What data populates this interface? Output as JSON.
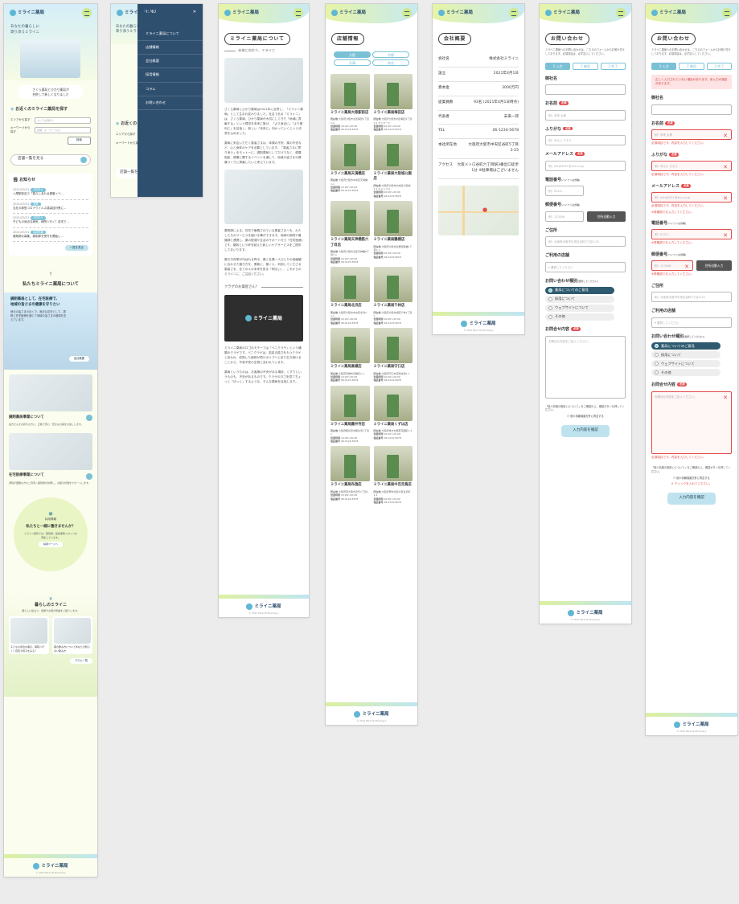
{
  "brand": {
    "name": "ミライニ薬局",
    "footer_copy": "© 2021 Mirai Ni Pharmacy"
  },
  "home": {
    "hero_text": [
      "あなたの暮らしに",
      "寄り添うミライニ"
    ],
    "hero_sub": [
      "さくら薬局とひかり薬局が",
      "合併して新しくなりました"
    ],
    "search_title": "お近くのミライニ薬局を探す",
    "area_label": "エリアから探す",
    "area_select": "エリアを選択",
    "keyword_label": "キーワードから探す",
    "keyword_placeholder": "店舗、キーワードなど",
    "search_button": "検索",
    "shop_list_button": "店舗一覧を見る",
    "news_title": "お知らせ",
    "news": [
      {
        "date": "2021/03/31",
        "tag": "お知らせ",
        "text": "八尾駅前店で「暮らしあれる健康イベ…"
      },
      {
        "date": "2021/03/31",
        "tag": "営業",
        "text": "当社の新型コロナウイルス感染症対策に…"
      },
      {
        "date": "2021/03/31",
        "tag": "お知らせ",
        "text": "子どもの身近な病気、病院へ行く？自宅で…"
      },
      {
        "date": "2021/03/31",
        "tag": "採用情報",
        "text": "薬剤師大募集。薬剤師を受付を開始し…"
      }
    ],
    "news_more": "一覧を見る",
    "about_title": "私たちミライニ薬局について",
    "about_box_title": [
      "調剤薬局として、在宅医療で、",
      "地域の皆さまの健康を守りたい"
    ],
    "about_box_text": "地元の皆さまの近くで、身近な存在として、調剤と在宅医療を通じて地域の皆さまの健康を支えています。",
    "about_more": "会社概要",
    "svc1_title": "調剤薬局事業について",
    "svc1_text": "処方せんをお持ちの方に、正確で安心・安全なお薬をお渡しします。",
    "svc2_title": "在宅医療事業について",
    "svc2_text": "通院が困難な方のご自宅へ薬剤師が訪問し、お薬の管理をサポートします。",
    "recruit_small": "採用情報",
    "recruit_title": "私たちと一緒に働きませんか？",
    "recruit_text": "ミライニ薬局では、薬剤師・医療事務スタッフを募集しています。",
    "recruit_btn": "採用ページへ",
    "column_title": "暮らしのミライニ",
    "column_sub": "暮らしに役立つ、健康やお薬の知識をご紹介します。",
    "column_items": [
      "子どもの身近な病気、病院へ行く？自宅で様子をみる？",
      "薬の飲み方についてあなたの知らない飲み方"
    ],
    "column_more": "コラム一覧"
  },
  "menu": {
    "title": "MENU",
    "items": [
      "ミライニ薬局について",
      "店舗情報",
      "会社概要",
      "採用情報",
      "コラム",
      "お問い合わせ"
    ],
    "peek_hero": [
      "あなたの暮らしに",
      "寄り添うミライニ"
    ],
    "peek_search": "お近くのミライニ薬局を探す",
    "peek_area": "エリアから探す",
    "peek_keyword": "キーワードから探す",
    "peek_shoplist": "店舗一覧を見る"
  },
  "about": {
    "title": "ミライニ薬局について",
    "subtitle": "未来に向かう、ミライニ",
    "p1": "さくら薬局とひかり薬局は2021年に合併し、「ミライニ薬局」として生まれ変わりました。社名である「ミライニ」は、さくら薬局、ひかり薬局が大切にしてきた「地域に貢献する」という理念を未来に繋げ、「より身近に」「より便利に」を目指し、新しい「未来に」向かっていくという決意を込めました。",
    "p2": "薬局に来店いただく患者さまは、体調の不安、薬の不安など、心と身体のケアを必要としています。「患者さまに寄り添う」をモットーに、調剤薬局としてだけでなく、健康相談、健康に関するイベントを通して、地域の皆さまの健康づくりに貢献したいと考えています。",
    "p3": "薬剤師による、在宅で療養されている患者さまへも、わたしたちのサービスを届ける事ができます。地域の病院や看護師と連携し、薬の配達や生活のサポート行う「在宅医療」です。薬剤という杯を越えた新しいケアサービスをご提供してまいります。",
    "p4": "働き方改革が叫ばれる昨今、働く社員一人ひとりの価値観に合わせた働き方を、柔軟に、働く人、利用してくださる患者さま、全ての人の未来を見る「明るい」、これからのミライニに、ご注目ください。",
    "sec2_title": "クラゲのお薬屋さん？",
    "p5": "ミライニ薬局のロゴのモチーフは「ベニクラゲ」という種類のクラゲです。ベニクラゲは、若返る能力をもつクラゲと言われ、成熟した個体が再びポリプへと戻り生き続けることから、不老不死の生物と言われています。",
    "p6": "薬局というものは、お客様の不安がある場所、くすりというものも、不安があるものです。クラゲのロゴを見てちょっと「ほっと」するような、そんな薬局を目指します。"
  },
  "shops": {
    "title": "店舗情報",
    "tabs": [
      "大阪",
      "京都",
      "兵庫",
      "奈良"
    ],
    "addr_label": "所在地",
    "hours_label": "営業時間",
    "tel_label": "電話番号",
    "hours": "10:00〜20:00",
    "tel": "06-0123-5678",
    "items": [
      {
        "name": "ミライニ薬局大阪駅前店",
        "addr": "大阪府大阪市北区梅田1丁目1-1"
      },
      {
        "name": "ミライニ薬局梅田店",
        "addr": "大阪府大阪市北区梅田1丁目1-1 サンワード"
      },
      {
        "name": "ミライニ薬局天満橋店",
        "addr": "大阪府大阪市中央区天満橋1-1"
      },
      {
        "name": "ミライニ薬局大阪城公園店",
        "addr": "大阪府大阪市中央区大阪城1-1 キャッスル"
      },
      {
        "name": "ミライニ薬局天神橋筋六丁目店",
        "addr": "大阪府大阪市北区天神橋6丁目1-1"
      },
      {
        "name": "ミライニ薬局鶴橋店",
        "addr": "大阪府大阪市生野区鶴橋1丁目1-1"
      },
      {
        "name": "ミライニ薬局北浜店",
        "addr": "大阪府大阪市中央区北浜1-1-1"
      },
      {
        "name": "ミライニ薬局千林店",
        "addr": "大阪府大阪市旭区千林1丁目1"
      },
      {
        "name": "ミライニ薬局高槻店",
        "addr": "大阪府高槻市高槻町1-1"
      },
      {
        "name": "ミライニ薬局守口店",
        "addr": "大阪府守口市京阪本通1-1"
      },
      {
        "name": "ミライニ薬局藤井寺店",
        "addr": "大阪府藤井寺市藤井寺1丁目1"
      },
      {
        "name": "ミライニ薬局くずは店",
        "addr": "大阪府枚方市楠葉花園町1-1"
      },
      {
        "name": "ミライニ薬局布施店",
        "addr": "大阪府東大阪市足代1丁目1"
      },
      {
        "name": "ミライニ薬局中百舌鳥店",
        "addr": "大阪府堺市北区中百舌鳥町1-1"
      }
    ]
  },
  "company": {
    "title": "会社概要",
    "rows": [
      {
        "k": "会社名",
        "v": "株式会社ミライニ"
      },
      {
        "k": "設立",
        "v": "2021年4月1日"
      },
      {
        "k": "資本金",
        "v": "3000万円"
      },
      {
        "k": "従業員数",
        "v": "93名 (2021年4月1日時点)"
      },
      {
        "k": "代表者",
        "v": "未来一郎"
      },
      {
        "k": "TEL",
        "v": "06-1234-5678"
      },
      {
        "k": "本社所在地",
        "v": "大阪府大阪市中央区谷町5丁目3-25"
      },
      {
        "k": "アクセス",
        "v": "大阪メトロ谷町六丁目駅3番出口徒歩1分 ※駐車場はございません"
      }
    ]
  },
  "contact": {
    "title": "お問い合わせ",
    "intro": "ミライニ薬局へのお問い合わせは、こちらのフォームからお受け付けしております。必須項目は、必ず記入してください。",
    "steps": [
      "1 入力",
      "2 確認",
      "3 完了"
    ],
    "err_banner": "正しく入力されていない項目があります。赤入力の項目があります。",
    "company_label": "御社名",
    "name_label": "お名前",
    "name_ph": "例）未来 太郎",
    "kana_label": "ふりがな",
    "kana_ph": "例）みらい たろう",
    "mail_label": "メールアドレス",
    "mail_ph": "例）mirai2021@xxx.co.jp",
    "tel_label": "電話番号",
    "tel_note": "(ハイフンは省略)",
    "tel_ph": "例）0120...",
    "zip_label": "郵便番号",
    "zip_note": "(ハイフンは省略)",
    "zip_ph": "例）123456",
    "zip_btn": "住所自動入力",
    "addr_label": "ご住所",
    "addr_ph": "例）大阪府大阪市中央区谷町5丁目3-25",
    "shop_label": "ご利用の店舗",
    "shop_ph": "選択してください",
    "type_label": "お問い合わせ種別",
    "type_note": "(選択してください)",
    "types": [
      "薬局についてのご意見",
      "採用について",
      "ウェブサイトについて",
      "その他"
    ],
    "body_label": "お問合せ内容",
    "body_ph": "お問合せ内容をご記入ください。",
    "req": "必須",
    "err_msg": "必須項目です。内容を入力してください。",
    "err_mail": "※再確認でお入力してください。",
    "err_check": "チェックを入れてください。",
    "privacy_text": "「個人情報の取扱いについて」をご確認の上、確認ボタンを押してください。",
    "privacy_check": "個人情報保護方針に同意する",
    "confirm_btn": "入力内容を確認"
  }
}
